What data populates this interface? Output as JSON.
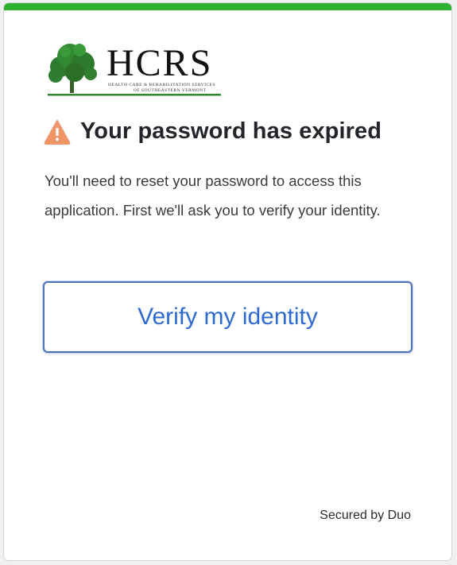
{
  "logo": {
    "name": "HCRS",
    "tagline": "HEALTH CARE & REHABILITATION SERVICES",
    "subtagline": "OF SOUTHEASTERN VERMONT"
  },
  "alert": {
    "icon": "warning-icon",
    "title": "Your password has expired",
    "message": "You'll need to reset your password to access this application. First we'll ask you to verify your identity."
  },
  "actions": {
    "verify_label": "Verify my identity"
  },
  "footer": {
    "secured_by": "Secured by Duo"
  },
  "colors": {
    "accent_bar": "#2eb030",
    "warning": "#f0956a",
    "button_text": "#2f6ad1",
    "button_border": "#4f73b5",
    "logo_green": "#2e7d32"
  }
}
